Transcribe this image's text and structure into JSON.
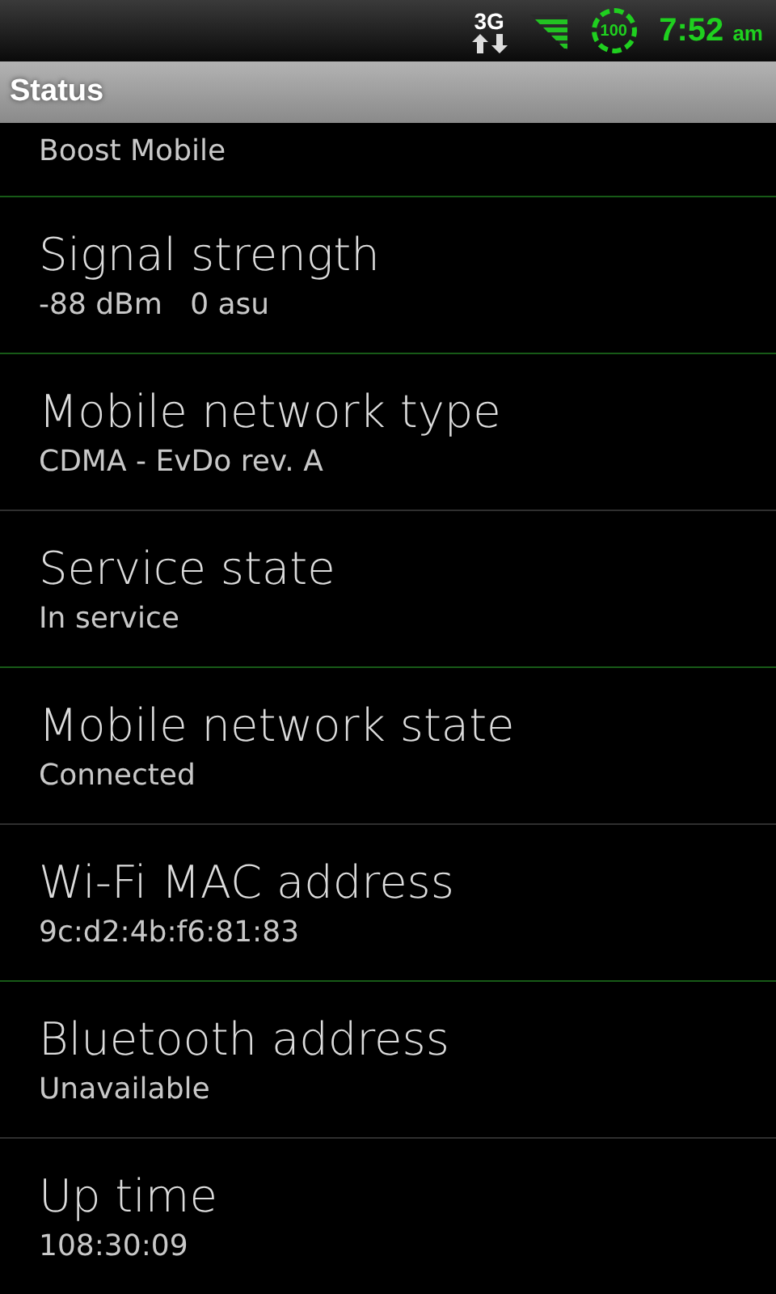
{
  "status_bar": {
    "network": "3G",
    "battery": "100",
    "time": "7:52",
    "ampm": "am"
  },
  "title": "Status",
  "rows": [
    {
      "summary": "Boost Mobile"
    },
    {
      "title": "Signal strength",
      "summary": "-88 dBm   0 asu"
    },
    {
      "title": "Mobile network type",
      "summary": "CDMA - EvDo rev. A"
    },
    {
      "title": "Service state",
      "summary": "In service"
    },
    {
      "title": "Mobile network state",
      "summary": "Connected"
    },
    {
      "title": "Wi-Fi MAC address",
      "summary": "9c:d2:4b:f6:81:83"
    },
    {
      "title": "Bluetooth address",
      "summary": "Unavailable"
    },
    {
      "title": "Up time",
      "summary": "108:30:09"
    }
  ]
}
